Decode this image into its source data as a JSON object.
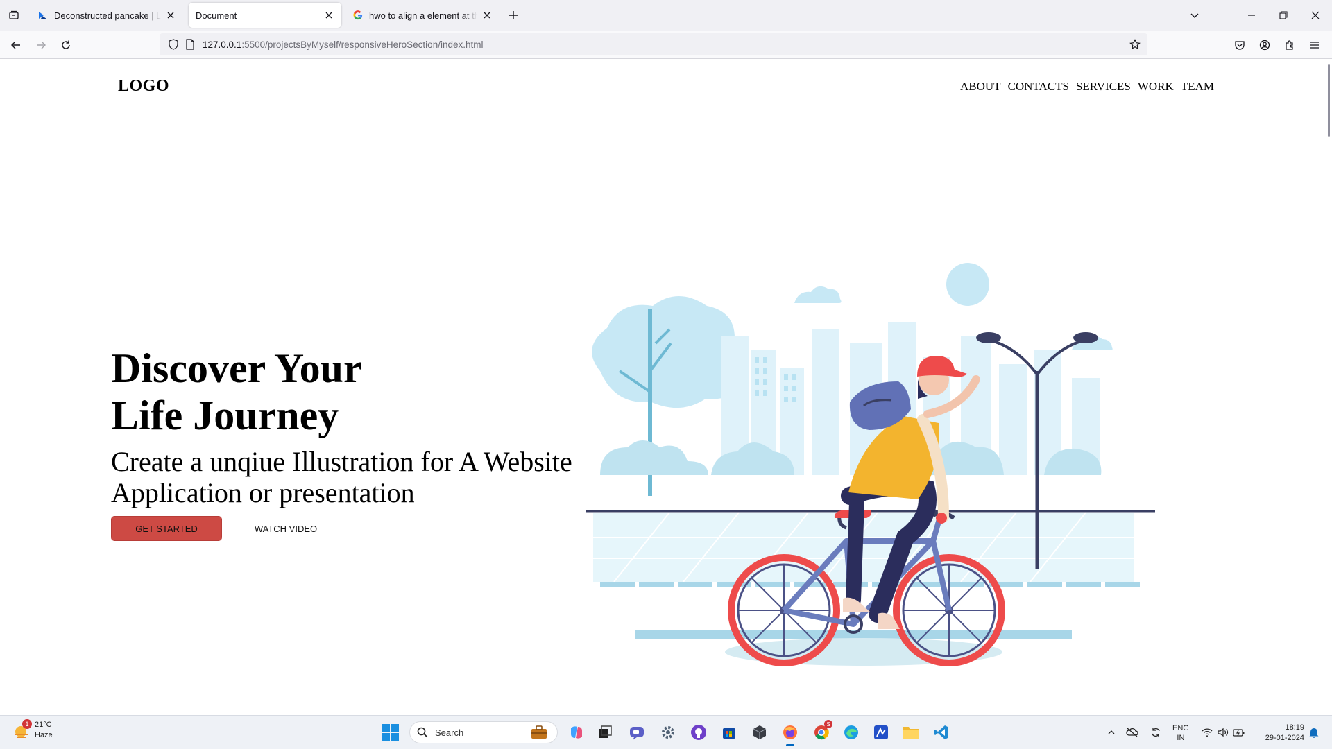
{
  "browser": {
    "tabs": [
      {
        "title": "Deconstructed pancake  |  Layout",
        "icon": "layout-favicon",
        "active": false
      },
      {
        "title": "Document",
        "icon": "none",
        "active": true
      },
      {
        "title": "hwo to align a element at the right",
        "icon": "google-favicon",
        "active": false
      }
    ],
    "url_host": "127.0.0.1",
    "url_rest": ":5500/projectsByMyself/responsiveHeroSection/index.html"
  },
  "page": {
    "logo": "LOGO",
    "nav": [
      "ABOUT",
      "CONTACTS",
      "SERVICES",
      "WORK",
      "TEAM"
    ],
    "hero_title_line1": "Discover Your",
    "hero_title_line2": "Life Journey",
    "hero_subtitle": "Create a unqiue Illustration for A Website Application or presentation",
    "btn_primary": "GET STARTED",
    "btn_secondary": "WATCH VIDEO",
    "colors": {
      "primary_button": "#cd4a44",
      "illustration_sky": "#bfe3f0",
      "bike_wheel": "#ee4b4b"
    }
  },
  "taskbar": {
    "weather_badge": "1",
    "weather_temp": "21°C",
    "weather_desc": "Haze",
    "search_label": "Search",
    "chrome_badge": "S",
    "lang_line1": "ENG",
    "lang_line2": "IN",
    "time": "18:19",
    "date": "29-01-2024"
  }
}
